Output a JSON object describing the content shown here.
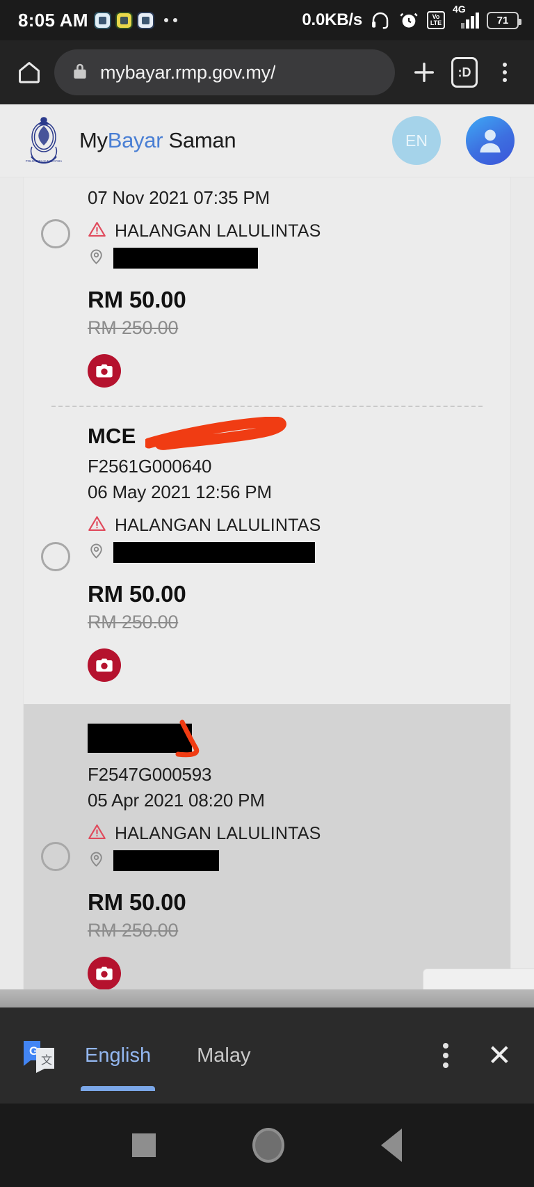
{
  "status_bar": {
    "time": "8:05 AM",
    "network_speed": "0.0KB/s",
    "volte_label_top": "Vo",
    "volte_label_bottom": "LTE",
    "network_type": "4G",
    "battery_percent": "71",
    "notification_icons": [
      "app-notification-icon",
      "app-notification-icon",
      "app-notification-icon"
    ],
    "overflow_dots": 2,
    "icons": [
      "headphone-icon",
      "alarm-icon",
      "volte-icon",
      "signal-icon",
      "battery-icon"
    ]
  },
  "browser": {
    "home_icon": "home-icon",
    "lock_icon": "lock-icon",
    "url": "mybayar.rmp.gov.my/",
    "new_tab_icon": "plus-icon",
    "tab_count": ":D",
    "menu_icon": "kebab-menu-icon"
  },
  "app_header": {
    "logo": "pdrm-crest-logo",
    "title_prefix": "My",
    "title_accent": "Bayar",
    "title_suffix": " Saman",
    "language_button": "EN",
    "account_icon": "user-avatar-icon"
  },
  "summons_list": [
    {
      "plate": "",
      "plate_redacted": true,
      "ticket_no": "",
      "datetime": "07 Nov 2021 07:35 PM",
      "offence": "HALANGAN LALULINTAS",
      "offence_icon": "warning-triangle-icon",
      "location_icon": "map-pin-icon",
      "location_redacted": true,
      "price": "RM 50.00",
      "original_price": "RM 250.00",
      "photo_icon": "camera-icon",
      "radio_icon": "radio-unchecked-icon",
      "selected": false,
      "partial_top": true
    },
    {
      "plate": "MCE",
      "plate_redacted": true,
      "ticket_no": "F2561G000640",
      "datetime": "06 May 2021 12:56 PM",
      "offence": "HALANGAN LALULINTAS",
      "offence_icon": "warning-triangle-icon",
      "location_icon": "map-pin-icon",
      "location_redacted": true,
      "price": "RM 50.00",
      "original_price": "RM 250.00",
      "photo_icon": "camera-icon",
      "radio_icon": "radio-unchecked-icon",
      "selected": false,
      "partial_top": false
    },
    {
      "plate": "",
      "plate_redacted": true,
      "ticket_no": "F2547G000593",
      "datetime": "05 Apr 2021 08:20 PM",
      "offence": "HALANGAN LALULINTAS",
      "offence_icon": "warning-triangle-icon",
      "location_icon": "map-pin-icon",
      "location_redacted": true,
      "price": "RM 50.00",
      "original_price": "RM 250.00",
      "photo_icon": "camera-icon",
      "radio_icon": "radio-unchecked-icon",
      "selected": true,
      "partial_top": false
    }
  ],
  "translate_bar": {
    "logo": "google-translate-icon",
    "source_language": "English",
    "target_language": "Malay",
    "active_language": "English",
    "menu_icon": "kebab-menu-icon",
    "close_icon": "close-icon"
  },
  "nav_bar": {
    "recents": "recents-square-icon",
    "home": "home-circle-icon",
    "back": "back-triangle-icon"
  },
  "colors": {
    "accent_blue": "#4a7fd4",
    "price_red": "#b5122e",
    "warning_red": "#e04a5c",
    "translate_active": "#93b7f0",
    "selected_row_bg": "#d3d3d3",
    "scribble_red": "#f03c13"
  }
}
